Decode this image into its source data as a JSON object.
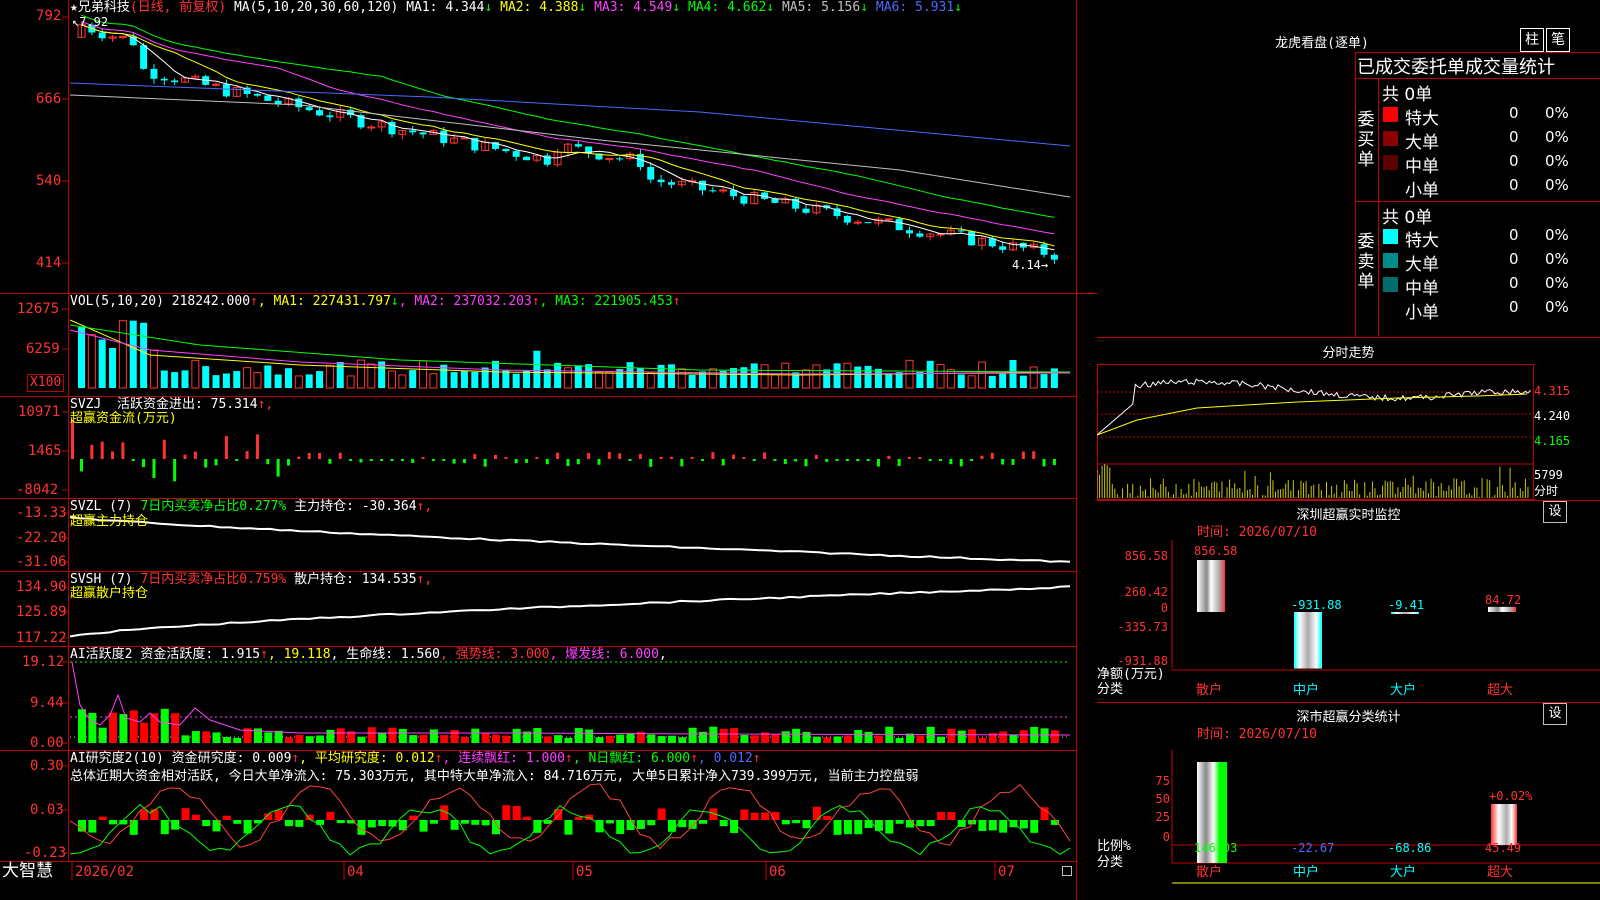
{
  "stock": {
    "star": "★",
    "name": "兄弟科技",
    "period": "(日线, 前复权)"
  },
  "main": {
    "ma_params": "MA(5,10,20,30,60,120)",
    "ma_items": [
      {
        "label": "MA1: 4.344",
        "arrow": "↓",
        "color": "#ffffff"
      },
      {
        "label": "MA2: 4.388",
        "arrow": "↓",
        "color": "#ffff00"
      },
      {
        "label": "MA3: 4.549",
        "arrow": "↓",
        "color": "#ff40ff"
      },
      {
        "label": "MA4: 4.662",
        "arrow": "↓",
        "color": "#00ff00"
      },
      {
        "label": "MA5: 5.156",
        "arrow": "↓",
        "color": "#c0c0c0"
      },
      {
        "label": "MA6: 5.931",
        "arrow": "↓",
        "color": "#4a6bff"
      }
    ],
    "y_ticks": [
      "792",
      "666",
      "540",
      "414"
    ],
    "high_label": "7.92",
    "low_label": "4.14"
  },
  "volume": {
    "title": "VOL(5,10,20)",
    "value": "218242.000",
    "value_arrow": "↑",
    "mas": [
      {
        "label": "MA1: 227431.797",
        "arrow": "↓",
        "color": "#ffff00"
      },
      {
        "label": "MA2: 237032.203",
        "arrow": "↑",
        "color": "#ff40ff"
      },
      {
        "label": "MA3: 221905.453",
        "arrow": "↑",
        "color": "#00ff00"
      }
    ],
    "y_ticks": [
      "12675",
      "6259"
    ],
    "unit": "X100"
  },
  "svzj": {
    "title": "SVZJ",
    "label": "活跃资金进出: 75.314",
    "arrow": "↑,",
    "sub": "超赢资金流(万元)",
    "y_ticks": [
      "10971",
      "1465",
      "-8042"
    ]
  },
  "svzl": {
    "title": "SVZL (7)",
    "desc": "7日内买卖净占比0.277%",
    "label": "主力持仓: -30.364",
    "arrow": "↑,",
    "sub": "超赢主力持仓",
    "y_ticks": [
      "-13.33",
      "-22.20",
      "-31.06"
    ]
  },
  "svsh": {
    "title": "SVSH (7)",
    "desc": "7日内买卖净占比0.759%",
    "label": "散户持仓: 134.535",
    "arrow": "↑,",
    "sub": "超赢散户持仓",
    "y_ticks": [
      "134.90",
      "125.89",
      "117.22"
    ]
  },
  "ai_active": {
    "title": "AI活跃度2",
    "label": "资金活跃度: 1.915",
    "a1": "↑",
    "v2": ", 19.118",
    "label3": ", 生命线: 1.560",
    "label4": ", 强势线: 3.000",
    "label5": ", 爆发线: 6.000",
    "end": ",",
    "y_ticks": [
      "19.12",
      "9.44",
      "0.00"
    ]
  },
  "ai_research": {
    "title": "AI研究度2(10)",
    "label": "资金研究度: 0.009",
    "a1": "↑",
    "label2": ", 平均研究度: 0.012",
    "a2": "↑",
    "label3": ", 连续飘红: 1.000",
    "a3": "↑",
    "label4": ", N日飘红: 6.000",
    "a4": "↑",
    "label5": ", 0.012",
    "a5": "↑",
    "summary": "总体近期大资金相对活跃, 今日大单净流入: 75.303万元, 其中特大单净流入: 84.716万元, 大单5日累计净入739.399万元, 当前主力控盘弱",
    "y_ticks": [
      "0.30",
      "0.03",
      "-0.23"
    ]
  },
  "x_axis": {
    "brand": "大智慧",
    "labels": [
      "2026/02",
      "04",
      "05",
      "06",
      "07"
    ]
  },
  "right": {
    "title": "龙虎看盘(逐单)",
    "btn1": "柱",
    "btn2": "笔",
    "stats_title": "已成交委托单成交量统计",
    "buy": {
      "side": "委买单",
      "total": "共 0单",
      "rows": [
        {
          "label": "特大",
          "val": "0",
          "pct": "0%",
          "color": "#ff0000"
        },
        {
          "label": "大单",
          "val": "0",
          "pct": "0%",
          "color": "#8b0000"
        },
        {
          "label": "中单",
          "val": "0",
          "pct": "0%",
          "color": "#5a0000"
        },
        {
          "label": "小单",
          "val": "0",
          "pct": "0%",
          "color": "#000000"
        }
      ]
    },
    "sell": {
      "side": "委卖单",
      "total": "共 0单",
      "rows": [
        {
          "label": "特大",
          "val": "0",
          "pct": "0%",
          "color": "#00ffff"
        },
        {
          "label": "大单",
          "val": "0",
          "pct": "0%",
          "color": "#008b8b"
        },
        {
          "label": "中单",
          "val": "0",
          "pct": "0%",
          "color": "#006d6d"
        },
        {
          "label": "小单",
          "val": "0",
          "pct": "0%",
          "color": "#000000"
        }
      ]
    },
    "intraday": {
      "title": "分时走势",
      "y_ticks": [
        "4.315",
        "4.240",
        "4.165"
      ],
      "vol_label": "5799",
      "vol_unit": "分时"
    },
    "monitor": {
      "title": "深圳超赢实时监控",
      "set": "设",
      "time": "时间: 2026/07/10",
      "y_ticks": [
        "856.58",
        "260.42",
        "0",
        "-335.73",
        "-931.88"
      ],
      "ylabel1": "净额(万元)",
      "ylabel2": "分类",
      "categories": [
        "散户",
        "中户",
        "大户",
        "超大"
      ],
      "values": [
        856.58,
        -931.88,
        -9.41,
        84.72
      ],
      "value_labels": [
        "856.58",
        "-931.88",
        "-9.41",
        "84.72"
      ]
    },
    "classify": {
      "title": "深市超赢分类统计",
      "set": "设",
      "time": "时间: 2026/07/10",
      "y_ticks": [
        "75",
        "50",
        "25",
        "0"
      ],
      "ylabel1": "比例%",
      "ylabel2": "分类",
      "categories": [
        "散户",
        "中户",
        "大户",
        "超大"
      ],
      "bottom_values": [
        "146.03",
        "-22.67",
        "-68.86",
        "45.49"
      ],
      "top_label": "+0.02%"
    }
  }
}
